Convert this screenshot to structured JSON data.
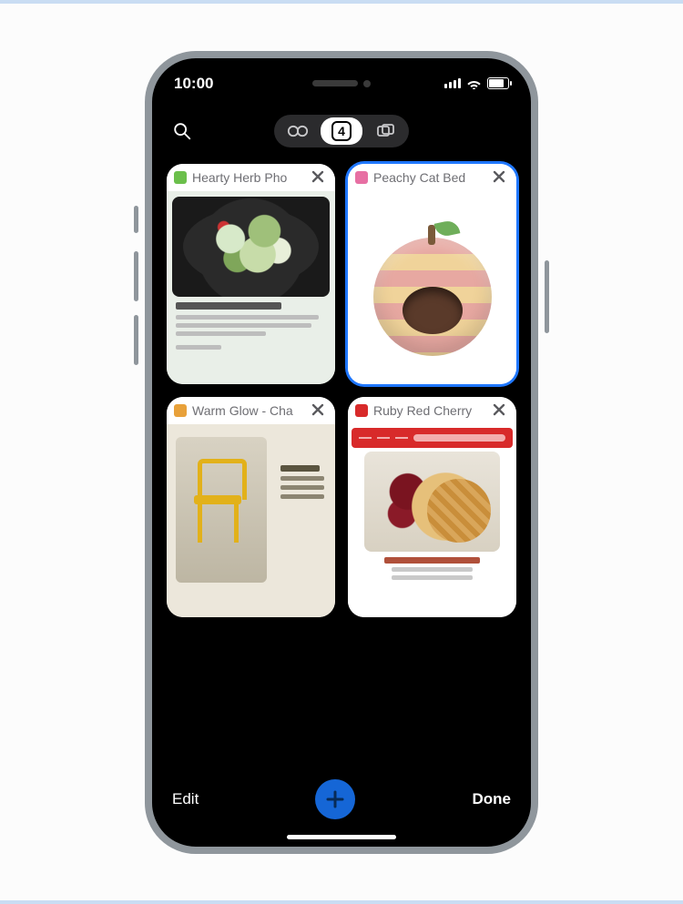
{
  "status": {
    "time": "10:00"
  },
  "controls": {
    "tab_count": "4"
  },
  "tabs": [
    {
      "title": "Hearty Herb Pho",
      "favicon_color": "#6bbf4b",
      "selected": false
    },
    {
      "title": "Peachy Cat Bed",
      "favicon_color": "#e76fa3",
      "selected": true
    },
    {
      "title": "Warm Glow - Cha",
      "favicon_color": "#e8a13a",
      "selected": false
    },
    {
      "title": "Ruby Red Cherry",
      "favicon_color": "#d82a2a",
      "selected": false
    }
  ],
  "bottom": {
    "edit_label": "Edit",
    "done_label": "Done"
  }
}
